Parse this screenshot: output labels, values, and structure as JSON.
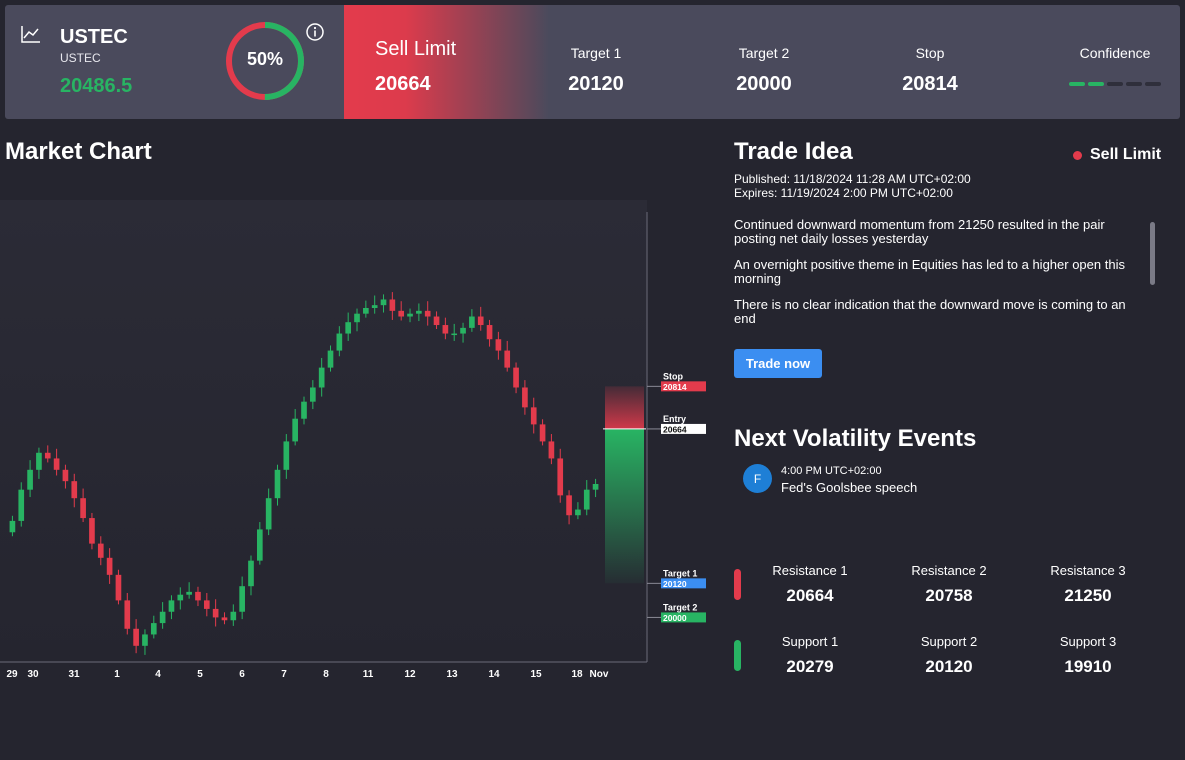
{
  "header": {
    "symbol": "USTEC",
    "symbol_sub": "USTEC",
    "price": "20486.5",
    "gauge_value": 50,
    "gauge_text": "50%",
    "signal_label": "Sell Limit",
    "signal_value": "20664",
    "metrics": [
      {
        "label": "Target 1",
        "value": "20120"
      },
      {
        "label": "Target 2",
        "value": "20000"
      },
      {
        "label": "Stop",
        "value": "20814"
      }
    ],
    "confidence_label": "Confidence",
    "confidence_level": 2,
    "confidence_max": 5,
    "colors": {
      "up": "#28b463",
      "down": "#e33b4c",
      "accent": "#3b8ef1"
    }
  },
  "market_chart": {
    "title": "Market Chart"
  },
  "chart_data": {
    "type": "candlestick",
    "x_tick_labels": [
      "29",
      "30",
      "31",
      "1",
      "4",
      "5",
      "6",
      "7",
      "8",
      "11",
      "12",
      "13",
      "14",
      "15",
      "18",
      "Nov"
    ],
    "ylim": [
      19850,
      21400
    ],
    "levels": [
      {
        "label": "Stop",
        "value": "20814",
        "color": "#e33b4c"
      },
      {
        "label": "Entry",
        "value": "20664",
        "color": "#ffffff"
      },
      {
        "label": "Target 1",
        "value": "20120",
        "color": "#3b8ef1"
      },
      {
        "label": "Target 2",
        "value": "20000",
        "color": "#28b463"
      }
    ],
    "closes": [
      20340,
      20450,
      20520,
      20580,
      20560,
      20520,
      20480,
      20420,
      20350,
      20260,
      20210,
      20150,
      20060,
      19960,
      19900,
      19940,
      19980,
      20020,
      20060,
      20080,
      20090,
      20060,
      20030,
      20000,
      19990,
      20020,
      20110,
      20200,
      20310,
      20420,
      20520,
      20620,
      20700,
      20760,
      20810,
      20880,
      20940,
      21000,
      21040,
      21070,
      21090,
      21100,
      21120,
      21080,
      21060,
      21070,
      21080,
      21060,
      21030,
      21000,
      21000,
      21020,
      21060,
      21030,
      20980,
      20940,
      20880,
      20810,
      20740,
      20680,
      20620,
      20560,
      20430,
      20360,
      20380,
      20450,
      20470
    ]
  },
  "trade_idea": {
    "title": "Trade Idea",
    "signal": "Sell Limit",
    "published": "Published:  11/18/2024 11:28 AM UTC+02:00",
    "expires": "Expires:  11/19/2024 2:00 PM UTC+02:00",
    "paragraphs": [
      "Continued downward momentum from 21250 resulted in the pair posting net daily losses yesterday",
      "An overnight positive theme in Equities has led to a higher open this morning",
      "There is no clear indication that the downward move is coming to an end"
    ],
    "button": "Trade now"
  },
  "events": {
    "title": "Next Volatility Events",
    "items": [
      {
        "badge": "F",
        "time": "4:00 PM UTC+02:00",
        "name": "Fed's Goolsbee speech"
      }
    ]
  },
  "levels": {
    "resistance": [
      {
        "label": "Resistance 1",
        "value": "20664"
      },
      {
        "label": "Resistance 2",
        "value": "20758"
      },
      {
        "label": "Resistance 3",
        "value": "21250"
      }
    ],
    "support": [
      {
        "label": "Support 1",
        "value": "20279"
      },
      {
        "label": "Support 2",
        "value": "20120"
      },
      {
        "label": "Support 3",
        "value": "19910"
      }
    ]
  }
}
